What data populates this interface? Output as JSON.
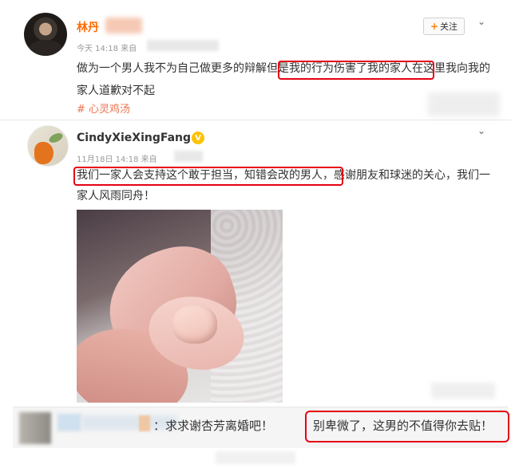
{
  "post1": {
    "author": "林丹",
    "follow_label": "关注",
    "follow_plus": "+",
    "timestamp": "今天 14:18 来自",
    "text_before": "做为一个男人我不为自己做更多的辩解",
    "text_highlight": "但是我的行为伤害了我的家人",
    "text_after": "在这里我向我的家人道歉对不起",
    "hashtag": "# 心灵鸡汤"
  },
  "post2": {
    "author": "CindyXieXingFang",
    "verified_badge": "V",
    "timestamp": "11月18日 14:18 来自",
    "text_highlight": "我们一家人会支持这个敢于担当，知错会改的男人",
    "text_after": "，感谢朋友和球迷的关心，我们一家人风雨同舟！"
  },
  "comment": {
    "text_left": "：求求谢杏芳离婚吧！",
    "text_highlight": "别卑微了，这男的不值得你去贴！"
  },
  "icons": {
    "menu_chevron": "⌄"
  },
  "colors": {
    "highlight_border": "#e60012",
    "author_name": "#ff6a00",
    "hashtag": "#eb7350",
    "verified": "#ffc200"
  }
}
